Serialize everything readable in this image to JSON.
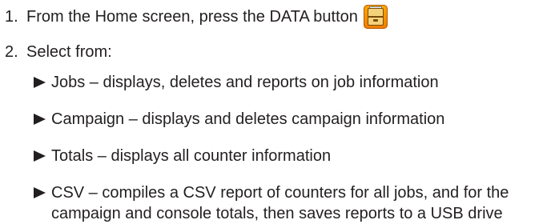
{
  "steps": [
    {
      "number": "1.",
      "text": "From the Home screen, press the DATA button",
      "icon": "data-button-icon"
    },
    {
      "number": "2.",
      "text": "Select from:"
    }
  ],
  "options": [
    "Jobs – displays, deletes and reports on job information",
    "Campaign – displays and deletes campaign information",
    "Totals – displays all counter information",
    "CSV – compiles a CSV report of counters for all jobs, and for the campaign and console totals, then saves reports to a USB drive"
  ],
  "colors": {
    "text": "#231f20",
    "icon_orange": "#f07c00"
  }
}
